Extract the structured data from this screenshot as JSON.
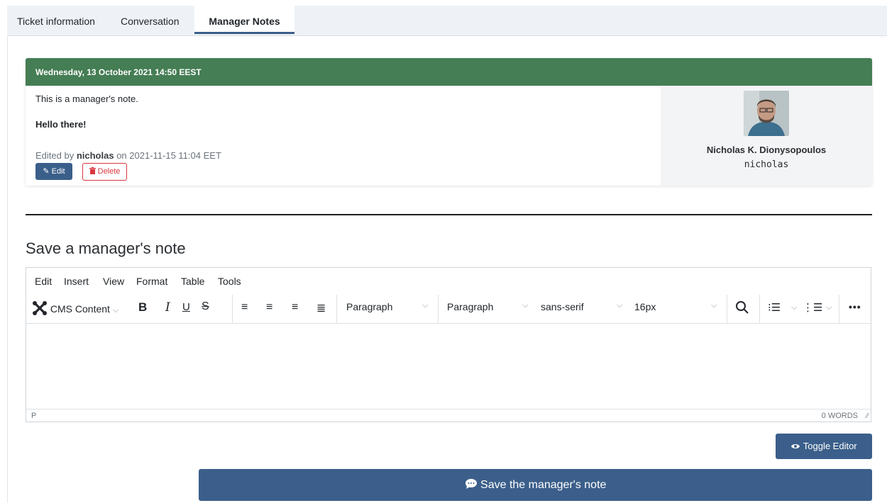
{
  "tabs": [
    {
      "label": "Ticket information",
      "active": false
    },
    {
      "label": "Conversation",
      "active": false
    },
    {
      "label": "Manager Notes",
      "active": true
    }
  ],
  "note": {
    "date_header": "Wednesday, 13 October 2021 14:50 EEST",
    "line1": "This is a manager's note.",
    "line2": "Hello there!",
    "edited_prefix": "Edited by",
    "edited_user": "nicholas",
    "edited_suffix": "on 2021-11-15 11:04 EET",
    "edit_label": "Edit",
    "delete_label": "Delete",
    "author_name": "Nicholas K. Dionysopoulos",
    "author_username": "nicholas",
    "header_color": "#457d54"
  },
  "section_title": "Save a manager's note",
  "editor": {
    "menus": [
      "Edit",
      "Insert",
      "View",
      "Format",
      "Table",
      "Tools"
    ],
    "cms_content_label": "CMS Content",
    "block_select_1": "Paragraph",
    "block_select_2": "Paragraph",
    "font_family": "sans-serif",
    "font_size": "16px",
    "status_path": "P",
    "word_count": "0 WORDS"
  },
  "buttons": {
    "toggle_editor": "Toggle Editor",
    "save_note": "Save the manager's note",
    "primary_color": "#3b5f8a"
  }
}
